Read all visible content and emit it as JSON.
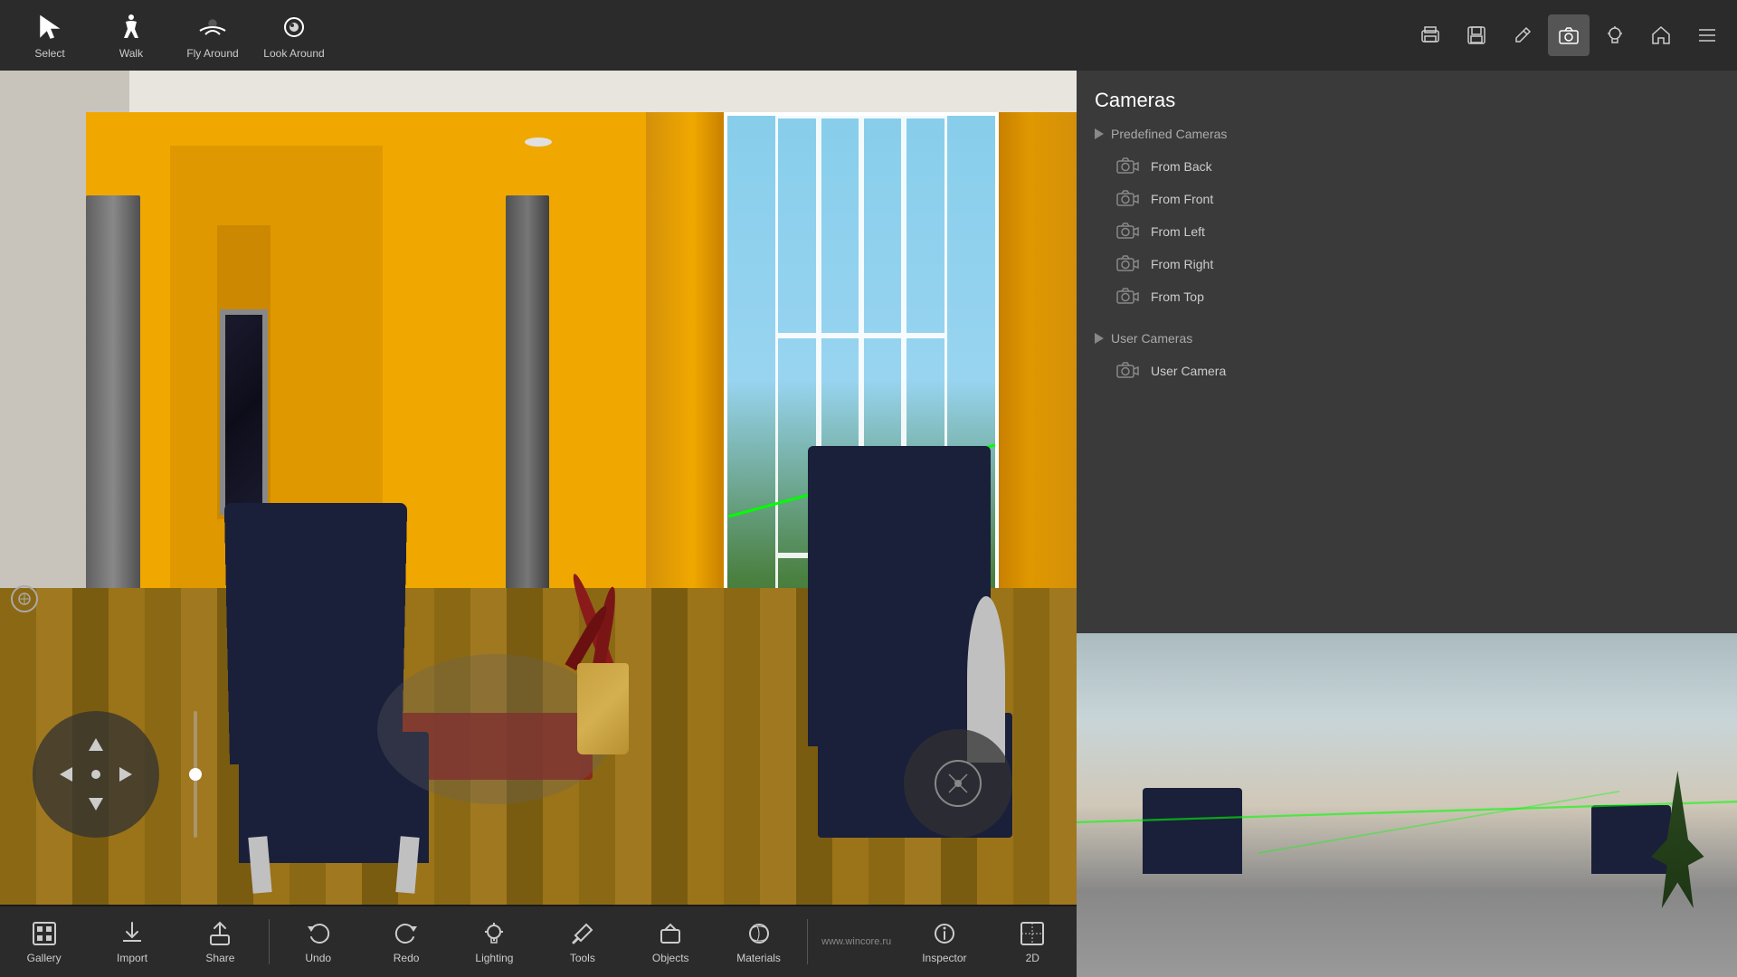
{
  "topToolbar": {
    "tools": [
      {
        "id": "select",
        "label": "Select",
        "icon": "cursor"
      },
      {
        "id": "walk",
        "label": "Walk",
        "icon": "walk"
      },
      {
        "id": "fly-around",
        "label": "Fly Around",
        "icon": "fly"
      },
      {
        "id": "look-around",
        "label": "Look Around",
        "icon": "look"
      }
    ]
  },
  "panelIcons": [
    {
      "id": "print",
      "icon": "print",
      "active": false
    },
    {
      "id": "save",
      "icon": "save",
      "active": false
    },
    {
      "id": "pencil",
      "icon": "pencil",
      "active": false
    },
    {
      "id": "camera",
      "icon": "camera",
      "active": true
    },
    {
      "id": "bulb",
      "icon": "bulb",
      "active": false
    },
    {
      "id": "home",
      "icon": "home",
      "active": false
    },
    {
      "id": "list",
      "icon": "list",
      "active": false
    }
  ],
  "camerasPanel": {
    "title": "Cameras",
    "predefinedSection": {
      "label": "Predefined Cameras",
      "cameras": [
        {
          "id": "from-back",
          "label": "From Back"
        },
        {
          "id": "from-front",
          "label": "From Front"
        },
        {
          "id": "from-left",
          "label": "From Left"
        },
        {
          "id": "from-right",
          "label": "From Right"
        },
        {
          "id": "from-top",
          "label": "From Top"
        }
      ]
    },
    "userSection": {
      "label": "User Cameras",
      "cameras": [
        {
          "id": "user-camera",
          "label": "User Camera"
        }
      ]
    }
  },
  "bottomToolbar": {
    "leftButtons": [
      {
        "id": "gallery",
        "label": "Gallery",
        "icon": "gallery"
      },
      {
        "id": "import",
        "label": "Import",
        "icon": "import"
      },
      {
        "id": "share",
        "label": "Share",
        "icon": "share"
      }
    ],
    "midButtons": [
      {
        "id": "undo",
        "label": "Undo",
        "icon": "undo"
      },
      {
        "id": "redo",
        "label": "Redo",
        "icon": "redo"
      }
    ],
    "rightButtons": [
      {
        "id": "lighting",
        "label": "Lighting",
        "icon": "lighting"
      },
      {
        "id": "tools",
        "label": "Tools",
        "icon": "tools"
      },
      {
        "id": "objects",
        "label": "Objects",
        "icon": "objects"
      },
      {
        "id": "materials",
        "label": "Materials",
        "icon": "materials"
      },
      {
        "id": "inspector",
        "label": "Inspector",
        "icon": "inspector"
      },
      {
        "id": "2d",
        "label": "2D",
        "icon": "2d"
      }
    ],
    "watermark": "www.wincore.ru",
    "mode": "2D"
  }
}
